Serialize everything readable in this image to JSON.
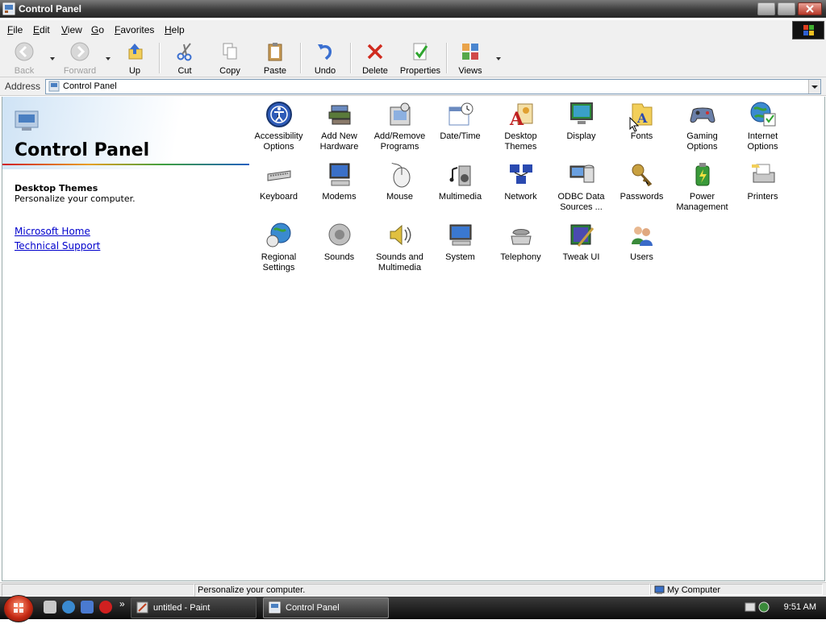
{
  "window": {
    "title": "Control Panel"
  },
  "menubar": {
    "items": [
      "File",
      "Edit",
      "View",
      "Go",
      "Favorites",
      "Help"
    ]
  },
  "toolbar": {
    "back": "Back",
    "forward": "Forward",
    "up": "Up",
    "cut": "Cut",
    "copy": "Copy",
    "paste": "Paste",
    "undo": "Undo",
    "delete": "Delete",
    "properties": "Properties",
    "views": "Views"
  },
  "address": {
    "label": "Address",
    "value": "Control Panel"
  },
  "leftpane": {
    "title": "Control Panel",
    "selected_name": "Desktop Themes",
    "selected_desc": "Personalize your computer.",
    "links": [
      "Microsoft Home",
      "Technical Support"
    ]
  },
  "icons": [
    {
      "label": "Accessibility Options",
      "icon": "accessibility-icon"
    },
    {
      "label": "Add New Hardware",
      "icon": "hardware-icon"
    },
    {
      "label": "Add/Remove Programs",
      "icon": "programs-icon"
    },
    {
      "label": "Date/Time",
      "icon": "calendar-clock-icon"
    },
    {
      "label": "Desktop Themes",
      "icon": "themes-icon"
    },
    {
      "label": "Display",
      "icon": "monitor-icon"
    },
    {
      "label": "Fonts",
      "icon": "fonts-folder-icon"
    },
    {
      "label": "Gaming Options",
      "icon": "gamepad-icon"
    },
    {
      "label": "Internet Options",
      "icon": "globe-icon"
    },
    {
      "label": "Keyboard",
      "icon": "keyboard-icon"
    },
    {
      "label": "Modems",
      "icon": "modem-icon"
    },
    {
      "label": "Mouse",
      "icon": "mouse-icon"
    },
    {
      "label": "Multimedia",
      "icon": "speaker-icon"
    },
    {
      "label": "Network",
      "icon": "network-icon"
    },
    {
      "label": "ODBC Data Sources ...",
      "icon": "odbc-icon"
    },
    {
      "label": "Passwords",
      "icon": "keys-icon"
    },
    {
      "label": "Power Management",
      "icon": "power-icon"
    },
    {
      "label": "Printers",
      "icon": "printer-icon"
    },
    {
      "label": "Regional Settings",
      "icon": "regional-globe-icon"
    },
    {
      "label": "Sounds",
      "icon": "sound-icon"
    },
    {
      "label": "Sounds and Multimedia",
      "icon": "sound-multimedia-icon"
    },
    {
      "label": "System",
      "icon": "system-icon"
    },
    {
      "label": "Telephony",
      "icon": "telephone-icon"
    },
    {
      "label": "Tweak UI",
      "icon": "tweakui-icon"
    },
    {
      "label": "Users",
      "icon": "users-icon"
    }
  ],
  "statusbar": {
    "message": "Personalize your computer.",
    "zone": "My Computer"
  },
  "taskbar": {
    "tasks": [
      "untitled - Paint",
      "Control Panel"
    ],
    "overflow": "»",
    "clock": "9:51 AM"
  }
}
